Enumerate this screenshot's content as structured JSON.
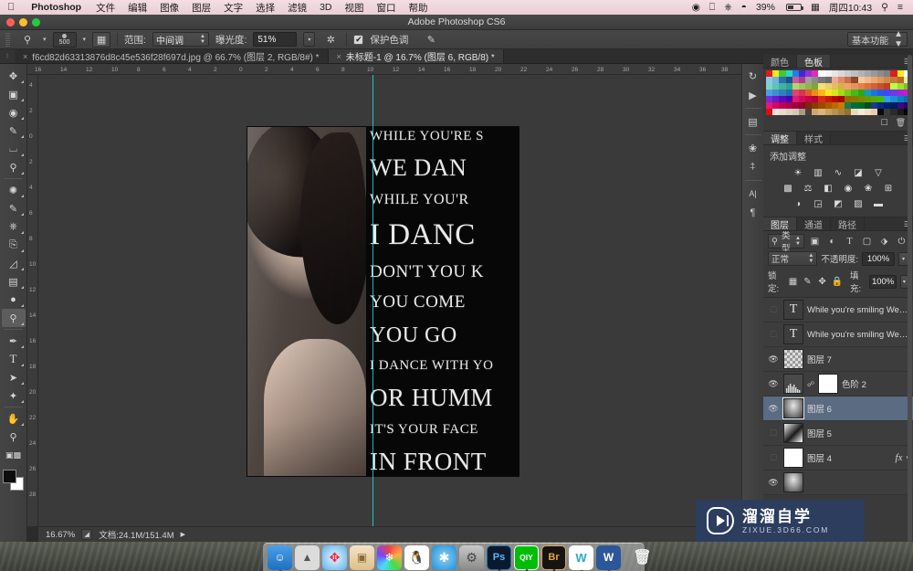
{
  "menubar": {
    "apple_icon": "apple-icon",
    "app_name": "Photoshop",
    "items": [
      "文件",
      "编辑",
      "图像",
      "图层",
      "文字",
      "选择",
      "滤镜",
      "3D",
      "视图",
      "窗口",
      "帮助"
    ],
    "status": {
      "airplay_icon": "airplay-icon",
      "bluetooth_icon": "bluetooth-icon",
      "wifi_icon": "wifi-icon",
      "battery_percent": "39%",
      "input_icon": "input-source-icon",
      "datetime": "周四10:43",
      "search_icon": "search-icon",
      "notification_icon": "notification-center-icon"
    }
  },
  "titlebar": {
    "title": "Adobe Photoshop CS6"
  },
  "options_bar": {
    "tool_icon": "dodge-tool-icon",
    "brush_size": "500",
    "brush_preset_icon": "brush-preset-picker-icon",
    "range_label": "范围:",
    "range_value": "中间调",
    "exposure_label": "曝光度:",
    "exposure_value": "51%",
    "airbrush_icon": "airbrush-icon",
    "protect_tones_label": "保护色调",
    "protect_tones_checked": "✔",
    "tablet_pressure_icon": "tablet-pressure-icon",
    "workspace": "基本功能"
  },
  "tabs": [
    {
      "label": "f6cd82d63313876d8c45e536f28f697d.jpg @ 66.7% (图层 2, RGB/8#) *",
      "active": false,
      "close": "×"
    },
    {
      "label": "未标题-1 @ 16.7% (图层 6, RGB/8) *",
      "active": true,
      "close": "×"
    }
  ],
  "rulers": {
    "horizontal_ticks": [
      "16",
      "14",
      "12",
      "10",
      "8",
      "6",
      "4",
      "2",
      "0",
      "2",
      "4",
      "6",
      "8",
      "10",
      "12",
      "14",
      "16",
      "18",
      "20",
      "22",
      "24",
      "26",
      "28",
      "30",
      "32",
      "34",
      "36",
      "38"
    ],
    "vertical_ticks": [
      "4",
      "2",
      "0",
      "2",
      "4",
      "6",
      "8",
      "10",
      "12",
      "14",
      "16",
      "18",
      "20",
      "22",
      "24",
      "26",
      "28"
    ]
  },
  "toolbar": {
    "tools": [
      {
        "name": "move-tool",
        "glyph": "✥",
        "selected": false
      },
      {
        "name": "marquee-tool",
        "glyph": "▭",
        "selected": false
      },
      {
        "name": "lasso-tool",
        "glyph": "◯",
        "selected": false
      },
      {
        "name": "quick-selection-tool",
        "glyph": "✎",
        "selected": false
      },
      {
        "name": "crop-tool",
        "glyph": "⌗",
        "selected": false
      },
      {
        "name": "eyedropper-tool",
        "glyph": "⚲",
        "selected": false
      },
      {
        "name": "healing-brush-tool",
        "glyph": "✺",
        "selected": false
      },
      {
        "name": "brush-tool",
        "glyph": "✐",
        "selected": false
      },
      {
        "name": "clone-stamp-tool",
        "glyph": "⌶",
        "selected": false
      },
      {
        "name": "history-brush-tool",
        "glyph": "⌁",
        "selected": false
      },
      {
        "name": "eraser-tool",
        "glyph": "◱",
        "selected": false
      },
      {
        "name": "gradient-tool",
        "glyph": "▤",
        "selected": false
      },
      {
        "name": "blur-tool",
        "glyph": "◌",
        "selected": false
      },
      {
        "name": "dodge-tool",
        "glyph": "🔍",
        "selected": true
      },
      {
        "name": "pen-tool",
        "glyph": "✒",
        "selected": false
      },
      {
        "name": "type-tool",
        "glyph": "T",
        "selected": false
      },
      {
        "name": "path-selection-tool",
        "glyph": "➤",
        "selected": false
      },
      {
        "name": "shape-tool",
        "glyph": "✦",
        "selected": false
      },
      {
        "name": "hand-tool",
        "glyph": "✋",
        "selected": false
      },
      {
        "name": "zoom-tool",
        "glyph": "⚲",
        "selected": false
      }
    ],
    "quickmask_icon": "quick-mask-icon",
    "foreground_color": "#0d0d0d",
    "background_color": "#ffffff"
  },
  "canvas": {
    "zoom": "16.67%",
    "guide_color": "#1fd8d8",
    "poster_lines": [
      "WHILE YOU'RE S",
      "WE DAN",
      "WHILE YOU'R",
      "I DANC",
      "DON'T YOU K",
      "YOU COME",
      "YOU GO",
      "I DANCE WITH YO",
      "OR HUMM",
      "IT'S YOUR FACE",
      "IN FRONT"
    ]
  },
  "icon_dock": [
    {
      "name": "history-panel-icon",
      "glyph": "↻"
    },
    {
      "name": "actions-panel-icon",
      "glyph": "▶"
    },
    {
      "name": "properties-panel-icon",
      "glyph": "▤"
    },
    {
      "name": "brush-panel-icon",
      "glyph": "✾"
    },
    {
      "name": "brush-presets-panel-icon",
      "glyph": "⚏"
    },
    {
      "name": "character-panel-icon",
      "glyph": "A|"
    },
    {
      "name": "paragraph-panel-icon",
      "glyph": "¶"
    }
  ],
  "color_panel": {
    "tabs": [
      {
        "label": "颜色",
        "active": false
      },
      {
        "label": "色板",
        "active": true
      }
    ],
    "menu_icon": "panel-menu-icon",
    "new_swatch_icon": "new-swatch-icon",
    "delete_swatch_icon": "delete-swatch-icon",
    "swatch_colors": [
      "#e21b1b",
      "#f8e71c",
      "#3ccc2b",
      "#2bd6c6",
      "#2b7be0",
      "#3a2bd6",
      "#9b2bd6",
      "#e02bc0",
      "#ffffff",
      "#f2f2f2",
      "#e6e6e6",
      "#d9d9d9",
      "#cccccc",
      "#bfbfbf",
      "#b3b3b3",
      "#a6a6a6",
      "#999999",
      "#8c8c8c",
      "#808080",
      "#e21b1b",
      "#f8e71c",
      "#ffffff",
      "#8fc6e8",
      "#6fb3e0",
      "#2f6fb0",
      "#1f4f8c",
      "#c85aa0",
      "#b23a8c",
      "#9e9e9e",
      "#8a8a8a",
      "#767676",
      "#6a6a6a",
      "#f0a98f",
      "#e08a6a",
      "#c96f4a",
      "#8c4a2a",
      "#f5c9a0",
      "#f0b98a",
      "#e8a870",
      "#d99a5f",
      "#cf8a4a",
      "#c47a3a",
      "#b86a2a",
      "#e8e8b0",
      "#7fd4c0",
      "#5fc4b0",
      "#3fb49f",
      "#2fa48f",
      "#b0d46f",
      "#9fc45f",
      "#8fb44f",
      "#7fa43f",
      "#f2e07a",
      "#e8d06a",
      "#e0c05a",
      "#d8b04a",
      "#f2a06a",
      "#ea905a",
      "#e2804a",
      "#da703a",
      "#d2603a",
      "#ca502a",
      "#c2401a",
      "#baff40",
      "#9fe030",
      "#7fc020",
      "#4f9fe0",
      "#3f8fd0",
      "#2f7fc0",
      "#1f6fb0",
      "#e2446a",
      "#d2345a",
      "#e25a2a",
      "#f08a1a",
      "#f8b81a",
      "#f8e81a",
      "#d8e81a",
      "#a8d81a",
      "#78c81a",
      "#48b81a",
      "#28a81a",
      "#1898ba",
      "#1878da",
      "#2858ea",
      "#3f48fa",
      "#6f38ea",
      "#9f28da",
      "#cf18ca",
      "#7a2ad6",
      "#6a1ac6",
      "#5a0ab6",
      "#4a00a6",
      "#e21b6a",
      "#d20b5a",
      "#c8004a",
      "#b8003a",
      "#d82a1a",
      "#c81a0a",
      "#b80a00",
      "#a80000",
      "#986a00",
      "#887a00",
      "#788a00",
      "#689a00",
      "#58aa00",
      "#48ba00",
      "#2aa0e0",
      "#1a90d0",
      "#0a80c0",
      "#0070b0",
      "#e2187a",
      "#d2086a",
      "#c2005a",
      "#b2004a",
      "#a20040",
      "#920030",
      "#7a2a00",
      "#8a3a00",
      "#9a4a00",
      "#aa5a00",
      "#ba6a00",
      "#ca7a00",
      "#1a7a4a",
      "#0a6a3a",
      "#006a2a",
      "#00501a",
      "#1a3a8a",
      "#0a2a7a",
      "#00206a",
      "#001a5a",
      "#3a0a7a",
      "#2a006a",
      "#e20a0a",
      "#efe6d8",
      "#e6dcc8",
      "#ddd2bc",
      "#d4c8b0",
      "#a89a88",
      "#4a3f35",
      "#caa870",
      "#d8b67a",
      "#c8a060",
      "#b89050",
      "#a88040",
      "#986f30",
      "#e8dcc0",
      "#f5ead8",
      "#f0ddc0",
      "#e8cfa8",
      "#0a0a0a",
      "#3a3a3a",
      "#2a2a2a",
      "#1a1a1a",
      "#000000"
    ]
  },
  "adjustments_panel": {
    "tabs": [
      {
        "label": "调整",
        "active": true
      },
      {
        "label": "样式",
        "active": false
      }
    ],
    "title": "添加调整",
    "menu_icon": "panel-menu-icon",
    "icons": [
      [
        {
          "name": "brightness-contrast-icon",
          "glyph": "☀"
        },
        {
          "name": "levels-icon",
          "glyph": "▥"
        },
        {
          "name": "curves-icon",
          "glyph": "∿"
        },
        {
          "name": "exposure-icon",
          "glyph": "◪"
        },
        {
          "name": "vibrance-icon",
          "glyph": "▽"
        }
      ],
      [
        {
          "name": "hue-saturation-icon",
          "glyph": "▩"
        },
        {
          "name": "color-balance-icon",
          "glyph": "⚖"
        },
        {
          "name": "black-white-icon",
          "glyph": "◧"
        },
        {
          "name": "photo-filter-icon",
          "glyph": "◉"
        },
        {
          "name": "channel-mixer-icon",
          "glyph": "❀"
        },
        {
          "name": "color-lookup-icon",
          "glyph": "⊞"
        }
      ],
      [
        {
          "name": "invert-icon",
          "glyph": "◑"
        },
        {
          "name": "posterize-icon",
          "glyph": "◲"
        },
        {
          "name": "threshold-icon",
          "glyph": "◩"
        },
        {
          "name": "selective-color-icon",
          "glyph": "▨"
        },
        {
          "name": "gradient-map-icon",
          "glyph": "▬"
        }
      ]
    ]
  },
  "layers_panel": {
    "tabs": [
      {
        "label": "图层",
        "active": true
      },
      {
        "label": "通道",
        "active": false
      },
      {
        "label": "路径",
        "active": false
      }
    ],
    "menu_icon": "panel-menu-icon",
    "filter_label": "类型",
    "filter_search_icon": "search-icon",
    "filter_icons": [
      {
        "name": "filter-pixel-icon",
        "glyph": "▣"
      },
      {
        "name": "filter-adjustment-icon",
        "glyph": "◐"
      },
      {
        "name": "filter-type-icon",
        "glyph": "T"
      },
      {
        "name": "filter-shape-icon",
        "glyph": "▢"
      },
      {
        "name": "filter-smart-object-icon",
        "glyph": "⬗"
      },
      {
        "name": "filter-toggle-icon",
        "glyph": "⏻"
      }
    ],
    "blend_mode": "正常",
    "opacity_label": "不透明度:",
    "opacity_value": "100%",
    "lock_label": "锁定:",
    "lock_icons": [
      {
        "name": "lock-transparent-pixels-icon",
        "glyph": "▦"
      },
      {
        "name": "lock-image-pixels-icon",
        "glyph": "✎"
      },
      {
        "name": "lock-position-icon",
        "glyph": "✥"
      },
      {
        "name": "lock-all-icon",
        "glyph": "🔒"
      }
    ],
    "fill_label": "填充:",
    "fill_value": "100%",
    "layers": [
      {
        "name": "While you're smiling We d...",
        "visible": false,
        "thumb": "type",
        "selected": false,
        "fx": "",
        "linked": false
      },
      {
        "name": "While you're smiling We d...",
        "visible": false,
        "thumb": "type",
        "selected": false,
        "fx": "",
        "linked": false
      },
      {
        "name": "图层 7",
        "visible": true,
        "thumb": "checker",
        "selected": false,
        "fx": "",
        "linked": false
      },
      {
        "name": "色阶 2",
        "visible": true,
        "thumb": "levels",
        "selected": false,
        "fx": "",
        "linked": true,
        "mask": true
      },
      {
        "name": "图层 6",
        "visible": true,
        "thumb": "photo",
        "selected": true,
        "fx": "",
        "linked": false
      },
      {
        "name": "图层 5",
        "visible": false,
        "thumb": "dark",
        "selected": false,
        "fx": "",
        "linked": false
      },
      {
        "name": "图层 4",
        "visible": false,
        "thumb": "white",
        "selected": false,
        "fx": "fx",
        "linked": false
      }
    ]
  },
  "statusbar": {
    "zoom": "16.67%",
    "doc_info": "文档:24.1M/151.4M",
    "expand_icon": "expand-icon",
    "arrow_icon": "▶"
  },
  "watermark": {
    "logo_icon": "play-logo-icon",
    "title": "溜溜自学",
    "url": "ZIXUE.3D66.COM",
    "bg_color": "#2c3d5e"
  },
  "dock": [
    {
      "name": "finder",
      "label": "☺",
      "color": "#2e7fd4",
      "running": true
    },
    {
      "name": "launchpad",
      "label": "🚀",
      "color": "#d8d8d8",
      "running": false
    },
    {
      "name": "safari",
      "label": "🧭",
      "color": "#4aa8ea",
      "running": false
    },
    {
      "name": "preview",
      "label": "🖼",
      "color": "#e8e8e8",
      "running": false
    },
    {
      "name": "photos",
      "label": "❀",
      "color": "#ffffff",
      "running": false
    },
    {
      "name": "qq",
      "label": "🐧",
      "color": "#ffffff",
      "running": false
    },
    {
      "name": "app-store",
      "label": "A",
      "color": "#2e9fe0",
      "running": false
    },
    {
      "name": "system-preferences",
      "label": "⚙",
      "color": "#9a9a9a",
      "running": false
    },
    {
      "name": "photoshop",
      "label": "Ps",
      "color": "#0c1b2e",
      "running": true
    },
    {
      "name": "iqiyi",
      "label": "QIY",
      "color": "#00be06",
      "running": true
    },
    {
      "name": "bridge",
      "label": "Br",
      "color": "#1a1a1a",
      "running": true
    },
    {
      "name": "wps",
      "label": "W",
      "color": "#ffffff",
      "running": true
    },
    {
      "name": "word",
      "label": "W",
      "color": "#2b579a",
      "running": true
    },
    {
      "name": "trash",
      "label": "🗑",
      "color": "#cfcfcf",
      "running": false
    }
  ]
}
